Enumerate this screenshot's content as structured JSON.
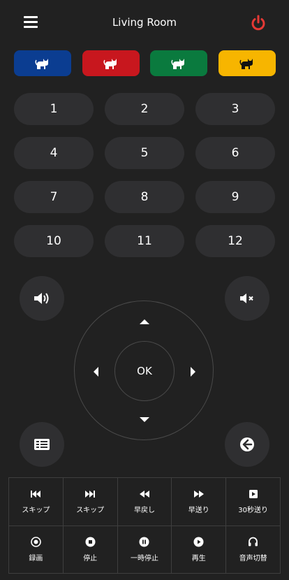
{
  "header": {
    "title": "Living Room",
    "menu_icon": "hamburger-icon",
    "power_icon": "power-icon",
    "power_color": "#e53935"
  },
  "color_buttons": [
    {
      "name": "blue",
      "color": "#0b3d91",
      "icon": "cat-icon"
    },
    {
      "name": "red",
      "color": "#c8171e",
      "icon": "cat-icon"
    },
    {
      "name": "green",
      "color": "#0a7a3e",
      "icon": "cat-icon"
    },
    {
      "name": "yellow",
      "color": "#f7b500",
      "icon": "cat-icon"
    }
  ],
  "numbers": [
    "1",
    "2",
    "3",
    "4",
    "5",
    "6",
    "7",
    "8",
    "9",
    "10",
    "11",
    "12"
  ],
  "controls": {
    "volume_icon": "volume-up-icon",
    "mute_icon": "mute-icon",
    "guide_icon": "program-guide-icon",
    "back_icon": "back-arrow-icon",
    "ok_label": "OK"
  },
  "playback": [
    {
      "label": "スキップ",
      "icon": "skip-back-icon"
    },
    {
      "label": "スキップ",
      "icon": "skip-forward-icon"
    },
    {
      "label": "早戻し",
      "icon": "rewind-icon"
    },
    {
      "label": "早送り",
      "icon": "fast-forward-icon"
    },
    {
      "label": "30秒送り",
      "icon": "skip-30-icon"
    },
    {
      "label": "録画",
      "icon": "record-icon"
    },
    {
      "label": "停止",
      "icon": "stop-icon"
    },
    {
      "label": "一時停止",
      "icon": "pause-icon"
    },
    {
      "label": "再生",
      "icon": "play-icon"
    },
    {
      "label": "音声切替",
      "icon": "headphones-icon"
    }
  ]
}
